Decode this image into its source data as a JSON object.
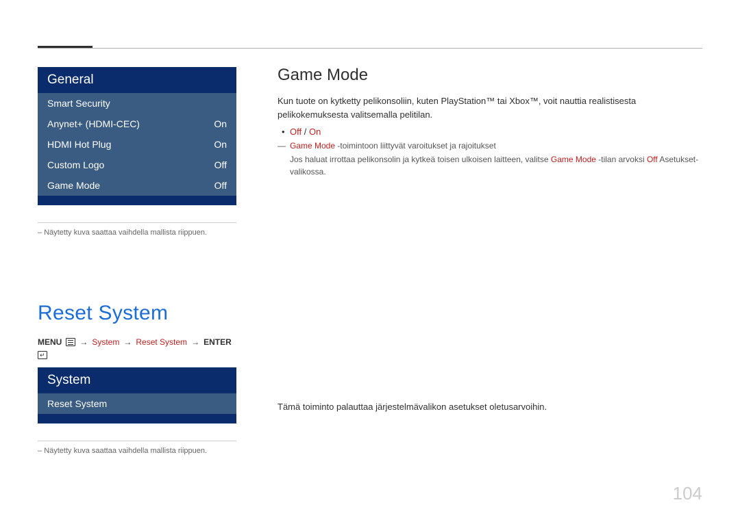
{
  "panel1": {
    "title": "General",
    "rows": [
      {
        "label": "Smart Security",
        "value": ""
      },
      {
        "label": "Anynet+ (HDMI-CEC)",
        "value": "On"
      },
      {
        "label": "HDMI Hot Plug",
        "value": "On"
      },
      {
        "label": "Custom Logo",
        "value": "Off"
      },
      {
        "label": "Game Mode",
        "value": "Off"
      }
    ]
  },
  "note1": "Näytetty kuva saattaa vaihdella mallista riippuen.",
  "section2_title": "Reset System",
  "breadcrumb": {
    "menu": "MENU",
    "p1": "System",
    "p2": "Reset System",
    "enter": "ENTER"
  },
  "panel2": {
    "title": "System",
    "rows": [
      {
        "label": "Reset System",
        "value": ""
      }
    ]
  },
  "note2": "Näytetty kuva saattaa vaihdella mallista riippuen.",
  "right": {
    "h2": "Game Mode",
    "para": "Kun tuote on kytketty pelikonsoliin, kuten PlayStation™ tai Xbox™, voit nauttia realistisesta pelikokemuksesta valitsemalla pelitilan.",
    "opt_off": "Off",
    "opt_sep": " / ",
    "opt_on": "On",
    "callout_red": "Game Mode",
    "callout_rest": " -toimintoon liittyvät varoitukset ja rajoitukset",
    "sub_pre": "Jos haluat irrottaa pelikonsolin ja kytkeä toisen ulkoisen laitteen, valitse ",
    "sub_gm": "Game Mode",
    "sub_mid": " -tilan arvoksi ",
    "sub_off": "Off",
    "sub_post": " Asetukset-valikossa.",
    "reset_desc": "Tämä toiminto palauttaa järjestelmävalikon asetukset oletusarvoihin."
  },
  "page_number": "104"
}
